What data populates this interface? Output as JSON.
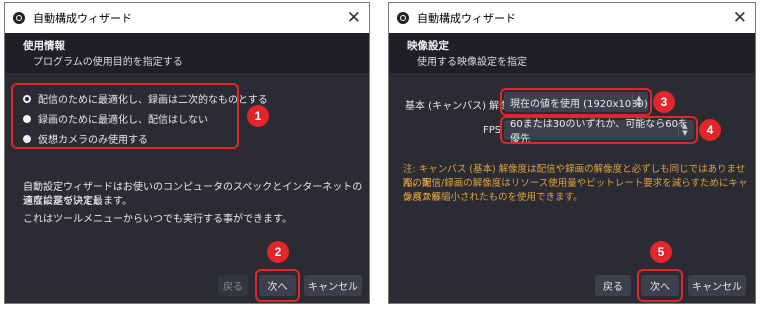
{
  "colors": {
    "annotation_red": "#e0252b",
    "note_orange": "#e0a13a",
    "window_bg": "#2b2c33"
  },
  "window1": {
    "title": "自動構成ウィザード",
    "header_title": "使用情報",
    "header_subtitle": "プログラムの使用目的を指定する",
    "options": [
      "配信のために最適化し、録画は二次的なものとする",
      "録画のために最適化し、配信はしない",
      "仮想カメラのみ使用する"
    ],
    "desc_line1": "自動設定ウィザードはお使いのコンピュータのスペックとインターネットの速度に基づいて最",
    "desc_line2": "適な設定を決定します。",
    "desc_line3": "これはツールメニューからいつでも実行する事ができます。",
    "back_label": "戻る",
    "next_label": "次へ",
    "cancel_label": "キャンセル",
    "badge_options": "1",
    "badge_next": "2"
  },
  "window2": {
    "title": "自動構成ウィザード",
    "header_title": "映像設定",
    "header_subtitle": "使用する映像設定を指定",
    "base_res_label": "基本 (キャンバス) 解像度",
    "base_res_value": "現在の値を使用 (1920x1080)",
    "fps_label": "FPS",
    "fps_value": "60または30のいずれか、可能なら60を優先",
    "note_line1": "注: キャンバス (基本) 解像度は配信や録画の解像度と必ずしも同じではありません。実",
    "note_line2": "際の配信/録画の解像度はリソース使用量やビットレート要求を減らすためにキャンバス解",
    "note_line3": "像度から縮小されたものを使用できます。",
    "back_label": "戻る",
    "next_label": "次へ",
    "cancel_label": "キャンセル",
    "badge_res": "3",
    "badge_fps": "4",
    "badge_next": "5"
  }
}
